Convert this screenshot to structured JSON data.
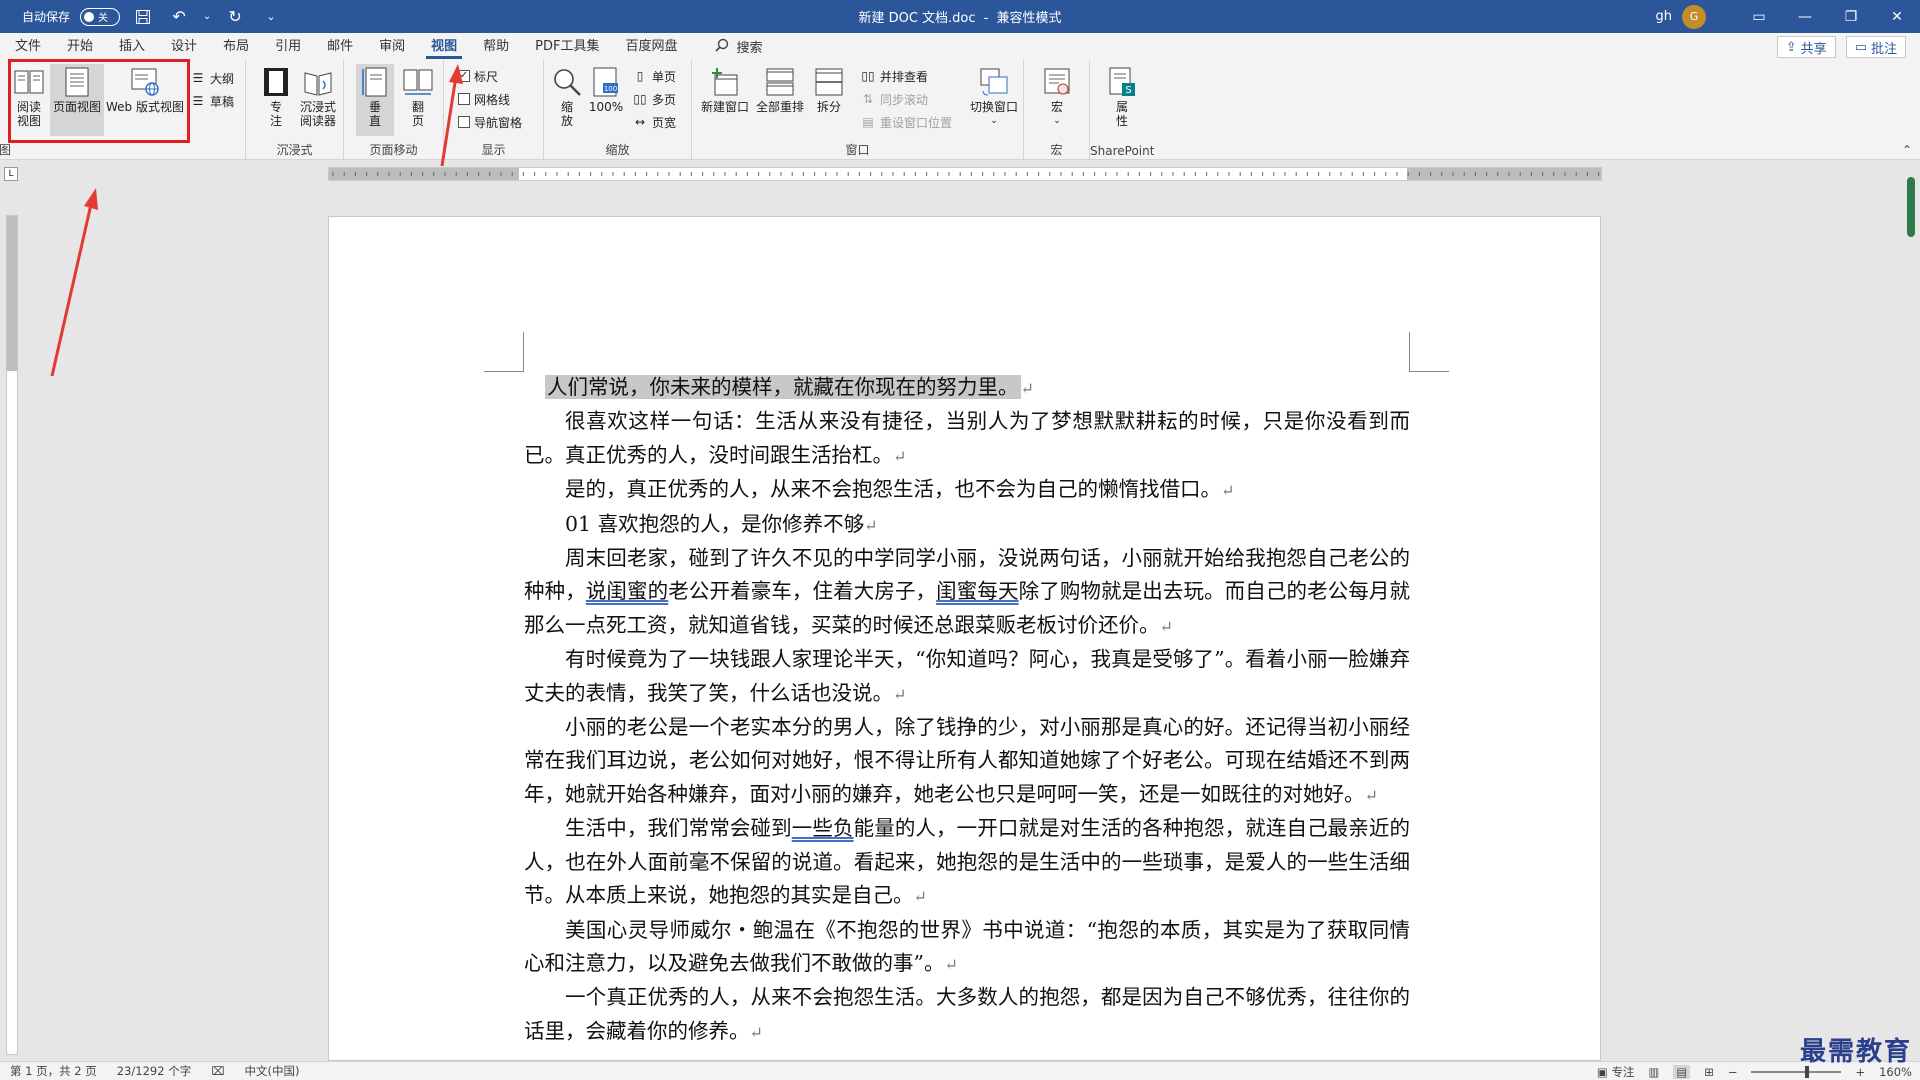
{
  "titlebar": {
    "autosave_label": "自动保存",
    "autosave_state": "关",
    "doc_title": "新建 DOC 文档.doc",
    "mode": "兼容性模式",
    "user": "gh",
    "avatar_letter": "G"
  },
  "tabs": [
    "文件",
    "开始",
    "插入",
    "设计",
    "布局",
    "引用",
    "邮件",
    "审阅",
    "视图",
    "帮助",
    "PDF工具集",
    "百度网盘"
  ],
  "active_tab": "视图",
  "search_label": "搜索",
  "share_label": "共享",
  "comments_label": "批注",
  "ribbon": {
    "views": {
      "label": "视图",
      "read_mode": "阅读\n视图",
      "print_layout": "页面视图",
      "web_layout": "Web 版式视图",
      "outline": "大纲",
      "draft": "草稿"
    },
    "immersive": {
      "label": "沉浸式",
      "focus": "专\n注",
      "reader": "沉浸式\n阅读器"
    },
    "page_move": {
      "label": "页面移动",
      "vertical": "垂\n直",
      "side": "翻\n页"
    },
    "show": {
      "label": "显示",
      "ruler": "标尺",
      "ruler_checked": true,
      "gridlines": "网格线",
      "nav_pane": "导航窗格"
    },
    "zoom": {
      "label": "缩放",
      "zoom": "缩\n放",
      "percent": "100%",
      "one_page": "单页",
      "multi_page": "多页",
      "page_width": "页宽"
    },
    "window": {
      "label": "窗口",
      "new_window": "新建窗口",
      "arrange_all": "全部重排",
      "split": "拆分",
      "side_by_side": "并排查看",
      "sync_scroll": "同步滚动",
      "reset_pos": "重设窗口位置",
      "switch": "切换窗口"
    },
    "macros": {
      "label": "宏",
      "macro": "宏"
    },
    "sharepoint": {
      "label": "SharePoint",
      "props": "属\n性"
    }
  },
  "document": {
    "title": "人们常说，你未来的模样，就藏在你现在的努力里。",
    "paragraphs": [
      [
        "很喜欢这样一句话：生活从来没有捷径，当别人为了梦想默默耕耘的时候，只是你没看到而已。真正优秀的人，没时间跟生活抬杠。"
      ],
      [
        "是的，真正优秀的人，从来不会抱怨生活，也不会为自己的懒惰找借口。"
      ],
      [
        "01  喜欢抱怨的人，是你修养不够"
      ],
      [
        "周末回老家，碰到了许久不见的中学同学小丽，没说两句话，小丽就开始给我抱怨自己老公的种种，",
        {
          "u": "说闺蜜的"
        },
        "老公开着豪车，住着大房子，",
        {
          "u": "闺蜜每天"
        },
        "除了购物就是出去玩。而自己的老公每月就那么一点死工资，就知道省钱，买菜的时候还总跟菜贩老板讨价还价。"
      ],
      [
        "有时候竟为了一块钱跟人家理论半天，“你知道吗？阿心，我真是受够了”。看着小丽一脸嫌弃丈夫的表情，我笑了笑，什么话也没说。"
      ],
      [
        "小丽的老公是一个老实本分的男人，除了钱挣的少，对小丽那是真心的好。还记得当初小丽经常在我们耳边说，老公如何对她好，恨不得让所有人都知道她嫁了个好老公。可现在结婚还不到两年，她就开始各种嫌弃，面对小丽的嫌弃，她老公也只是呵呵一笑，还是一如既往的对她好。"
      ],
      [
        "生活中，我们常常会碰到",
        {
          "u": "一些负"
        },
        "能量的人，一开口就是对生活的各种抱怨，就连自己最亲近的人，也在外人面前毫不保留的说道。看起来，她抱怨的是生活中的一些琐事，是爱人的一些生活细节。从本质上来说，她抱怨的其实是自己。"
      ],
      [
        "美国心灵导师威尔・鲍温在《不抱怨的世界》书中说道：“抱怨的本质，其实是为了获取同情心和注意力，以及避免去做我们不敢做的事”。"
      ],
      [
        "一个真正优秀的人，从来不会抱怨生活。大多数人的抱怨，都是因为自己不够优秀，往往你的话里，会藏着你的修养。"
      ]
    ]
  },
  "status": {
    "page": "第 1 页，共 2 页",
    "words": "23/1292 个字",
    "lang": "中文(中国)",
    "focus": "专注",
    "zoom": "160%"
  },
  "watermark": "最需教育",
  "colors": {
    "accent": "#2b579a",
    "highlight_box": "#e02020"
  }
}
